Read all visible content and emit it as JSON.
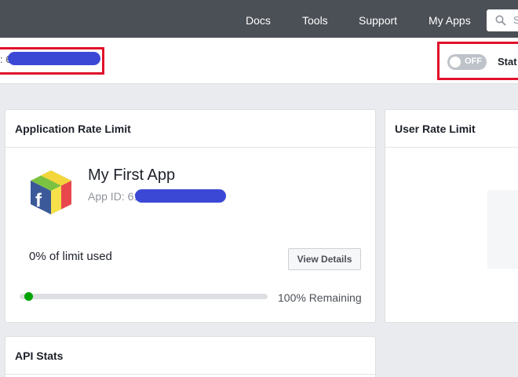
{
  "nav": {
    "links": [
      "Docs",
      "Tools",
      "Support",
      "My Apps"
    ],
    "search_placeholder": "S"
  },
  "subheader": {
    "app_id_prefix": ": 6",
    "toggle_label": "OFF",
    "status_label": "Stat"
  },
  "app_rate_card": {
    "title": "Application Rate Limit",
    "app_name": "My First App",
    "app_id_label": "App ID: 61",
    "limit_used_text": "0% of limit used",
    "limit_used_percent": 0,
    "view_details_label": "View Details",
    "remaining_text": "100% Remaining"
  },
  "user_rate_card": {
    "title": "User Rate Limit"
  },
  "api_stats_card": {
    "title": "API Stats"
  },
  "colors": {
    "nav_bg": "#4b4f56",
    "page_bg": "#e9ebee",
    "progress_green": "#00a400",
    "highlight_red": "#e0112b",
    "redaction_blue": "#3b48d6"
  },
  "icons": [
    "search-icon",
    "app-icon"
  ]
}
